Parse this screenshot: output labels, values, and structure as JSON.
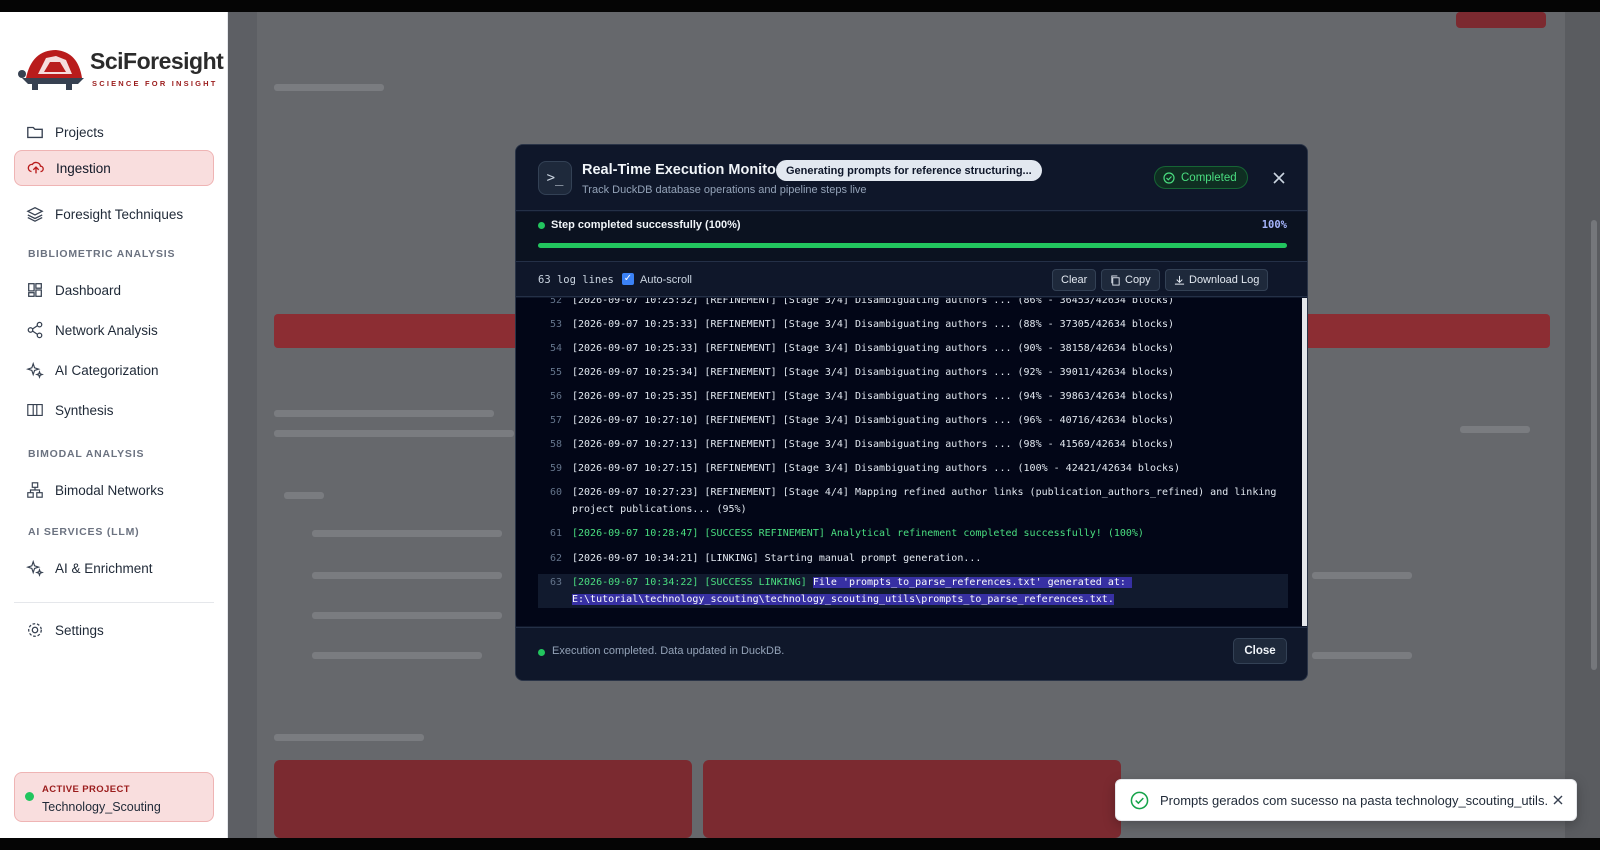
{
  "app": {
    "logo_title": "SciForesight",
    "logo_subtitle": "SCIENCE FOR INSIGHT"
  },
  "sidebar": {
    "items_top": [
      {
        "label": "Projects",
        "icon": "folder-icon"
      },
      {
        "label": "Ingestion",
        "icon": "cloud-upload-icon",
        "active": true
      },
      {
        "label": "Foresight Techniques",
        "icon": "layers-icon"
      }
    ],
    "section_bibliometric": "BIBLIOMETRIC ANALYSIS",
    "items_bibliometric": [
      {
        "label": "Dashboard",
        "icon": "grid-icon"
      },
      {
        "label": "Network Analysis",
        "icon": "share-nodes-icon"
      },
      {
        "label": "AI Categorization",
        "icon": "sparkles-icon"
      },
      {
        "label": "Synthesis",
        "icon": "book-icon"
      }
    ],
    "section_bimodal": "BIMODAL ANALYSIS",
    "items_bimodal": [
      {
        "label": "Bimodal Networks",
        "icon": "network-icon"
      }
    ],
    "section_ai": "AI SERVICES (LLM)",
    "items_ai": [
      {
        "label": "AI & Enrichment",
        "icon": "sparkles-icon"
      }
    ],
    "settings": {
      "label": "Settings",
      "icon": "gear-icon"
    },
    "active_project": {
      "label": "ACTIVE PROJECT",
      "name": "Technology_Scouting"
    }
  },
  "modal": {
    "title": "Real-Time Execution Monitor",
    "step_pill": "Generating prompts for reference structuring...",
    "subtitle": "Track DuckDB database operations and pipeline steps live",
    "status": "Completed",
    "progress": {
      "label": "Step completed successfully (100%)",
      "percent_text": "100%",
      "fraction": 1.0
    },
    "toolbar": {
      "line_count": "63 log lines",
      "autoscroll_label": "Auto-scroll",
      "autoscroll_checked": true,
      "clear": "Clear",
      "copy": "Copy",
      "download": "Download Log"
    },
    "log": [
      {
        "n": "52",
        "text": "[2026-09-07 10:25:32] [REFINEMENT] [Stage 3/4] Disambiguating authors ... (86% - 36453/42634 blocks)"
      },
      {
        "n": "53",
        "text": "[2026-09-07 10:25:33] [REFINEMENT] [Stage 3/4] Disambiguating authors ... (88% - 37305/42634 blocks)"
      },
      {
        "n": "54",
        "text": "[2026-09-07 10:25:33] [REFINEMENT] [Stage 3/4] Disambiguating authors ... (90% - 38158/42634 blocks)"
      },
      {
        "n": "55",
        "text": "[2026-09-07 10:25:34] [REFINEMENT] [Stage 3/4] Disambiguating authors ... (92% - 39011/42634 blocks)"
      },
      {
        "n": "56",
        "text": "[2026-09-07 10:25:35] [REFINEMENT] [Stage 3/4] Disambiguating authors ... (94% - 39863/42634 blocks)"
      },
      {
        "n": "57",
        "text": "[2026-09-07 10:27:10] [REFINEMENT] [Stage 3/4] Disambiguating authors ... (96% - 40716/42634 blocks)"
      },
      {
        "n": "58",
        "text": "[2026-09-07 10:27:13] [REFINEMENT] [Stage 3/4] Disambiguating authors ... (98% - 41569/42634 blocks)"
      },
      {
        "n": "59",
        "text": "[2026-09-07 10:27:15] [REFINEMENT] [Stage 3/4] Disambiguating authors ... (100% - 42421/42634 blocks)"
      },
      {
        "n": "60",
        "text": "[2026-09-07 10:27:23] [REFINEMENT] [Stage 4/4] Mapping refined author links (publication_authors_refined) and linking project publications... (95%)"
      },
      {
        "n": "61",
        "text": "[2026-09-07 10:28:47] [SUCCESS REFINEMENT] Analytical refinement completed successfully! (100%)",
        "kind": "success"
      },
      {
        "n": "62",
        "text": "[2026-09-07 10:34:21] [LINKING] Starting manual prompt generation..."
      },
      {
        "n": "63",
        "prefix": "[2026-09-07 10:34:22] [SUCCESS LINKING] ",
        "highlight": "File 'prompts_to_parse_references.txt' generated at: E:\\tutorial\\technology_scouting\\technology_scouting_utils\\prompts_to_parse_references.txt.",
        "kind": "success"
      }
    ],
    "footer_text": "Execution completed. Data updated in DuckDB.",
    "close_button": "Close"
  },
  "toast": {
    "message": "Prompts gerados com sucesso na pasta technology_scouting_utils."
  },
  "colors": {
    "accent_red": "#9b1c1c",
    "success_green": "#22c55e",
    "modal_bg": "#0f172a"
  }
}
